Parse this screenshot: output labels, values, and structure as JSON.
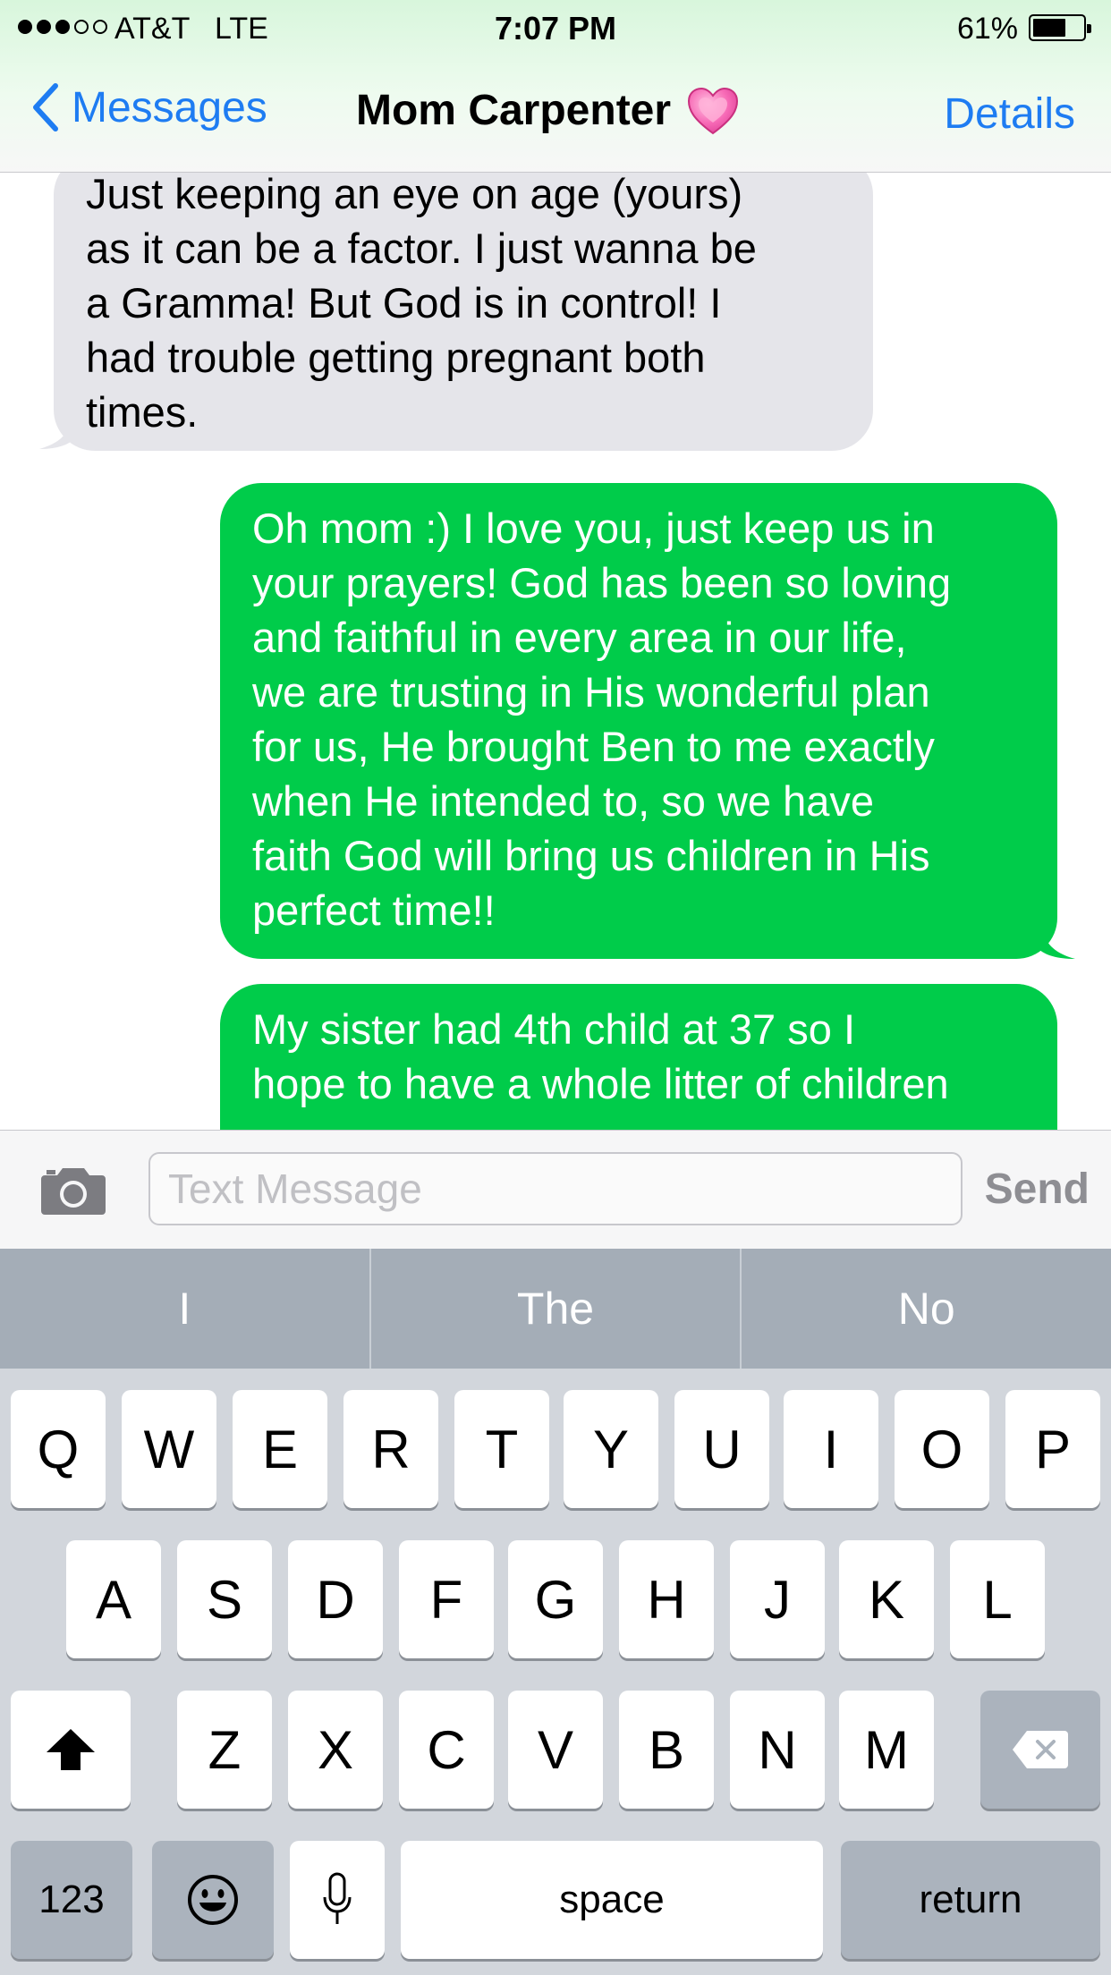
{
  "status_bar": {
    "carrier": "AT&T",
    "network": "LTE",
    "time": "7:07 PM",
    "battery_percent": "61%",
    "battery_level": 0.61,
    "signal_bars": 3,
    "signal_max": 5
  },
  "nav": {
    "back_label": "Messages",
    "contact_name": "Mom Carpenter",
    "contact_emoji": "pink-heart-icon",
    "details_label": "Details"
  },
  "messages": [
    {
      "direction": "incoming",
      "lines": [
        "Just keeping an eye on age (yours)",
        "as it can be a factor. I just wanna be",
        "a Gramma! But God is in control! I",
        "had trouble getting pregnant both",
        "times."
      ]
    },
    {
      "direction": "outgoing",
      "lines": [
        "Oh mom :) I love you, just keep us in",
        "your prayers! God has been so loving",
        "and faithful in every area in our life,",
        "we are trusting in His wonderful plan",
        "for us, He brought Ben to me exactly",
        "when He intended to, so we have",
        "faith God will bring us children in His",
        "perfect time!!"
      ]
    },
    {
      "direction": "outgoing",
      "lines": [
        "My sister had 4th child at 37 so I",
        "hope to have a whole litter of children"
      ]
    }
  ],
  "input_bar": {
    "placeholder": "Text Message",
    "send_label": "Send",
    "camera_icon": "camera-icon"
  },
  "predictions": [
    "I",
    "The",
    "No"
  ],
  "keyboard": {
    "row1": [
      "Q",
      "W",
      "E",
      "R",
      "T",
      "Y",
      "U",
      "I",
      "O",
      "P"
    ],
    "row2": [
      "A",
      "S",
      "D",
      "F",
      "G",
      "H",
      "J",
      "K",
      "L"
    ],
    "row3": [
      "Z",
      "X",
      "C",
      "V",
      "B",
      "N",
      "M"
    ],
    "numbers_label": "123",
    "space_label": "space",
    "return_label": "return",
    "shift_icon": "shift-icon",
    "delete_icon": "delete-icon",
    "emoji_icon": "emoji-icon",
    "mic_icon": "microphone-icon"
  },
  "colors": {
    "ios_blue": "#1e7cf2",
    "sms_green": "#00cc4a",
    "incoming_gray": "#e5e5ea"
  }
}
